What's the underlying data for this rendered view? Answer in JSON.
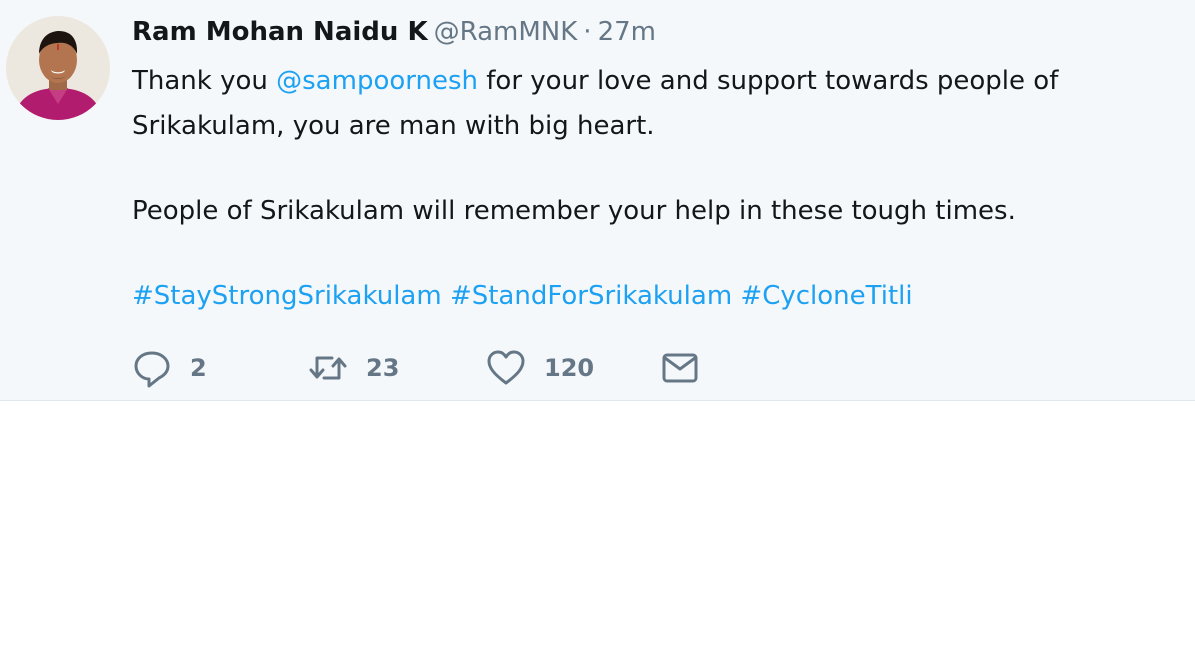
{
  "tweet": {
    "author_name": "Ram Mohan Naidu K",
    "handle": "@RamMNK",
    "separator": "·",
    "time": "27m",
    "body": {
      "line1_prefix": "Thank you ",
      "mention": "@sampoornesh",
      "line1_suffix": " for your love and support towards people of Srikakulam, you are man with big heart.",
      "paragraph2": "People of Srikakulam will remember your help in these tough times.",
      "hashtags": [
        "#StayStrongSrikakulam",
        "#StandForSrikakulam",
        "#CycloneTitli"
      ]
    },
    "actions": {
      "reply_count": "2",
      "retweet_count": "23",
      "like_count": "120"
    }
  },
  "colors": {
    "background": "#f5f8fa",
    "link": "#1da1f2",
    "text": "#14171a",
    "muted": "#657786"
  },
  "icons": {
    "avatar": "user-avatar-photo",
    "reply": "reply-icon",
    "retweet": "retweet-icon",
    "like": "heart-icon",
    "dm": "envelope-icon"
  }
}
